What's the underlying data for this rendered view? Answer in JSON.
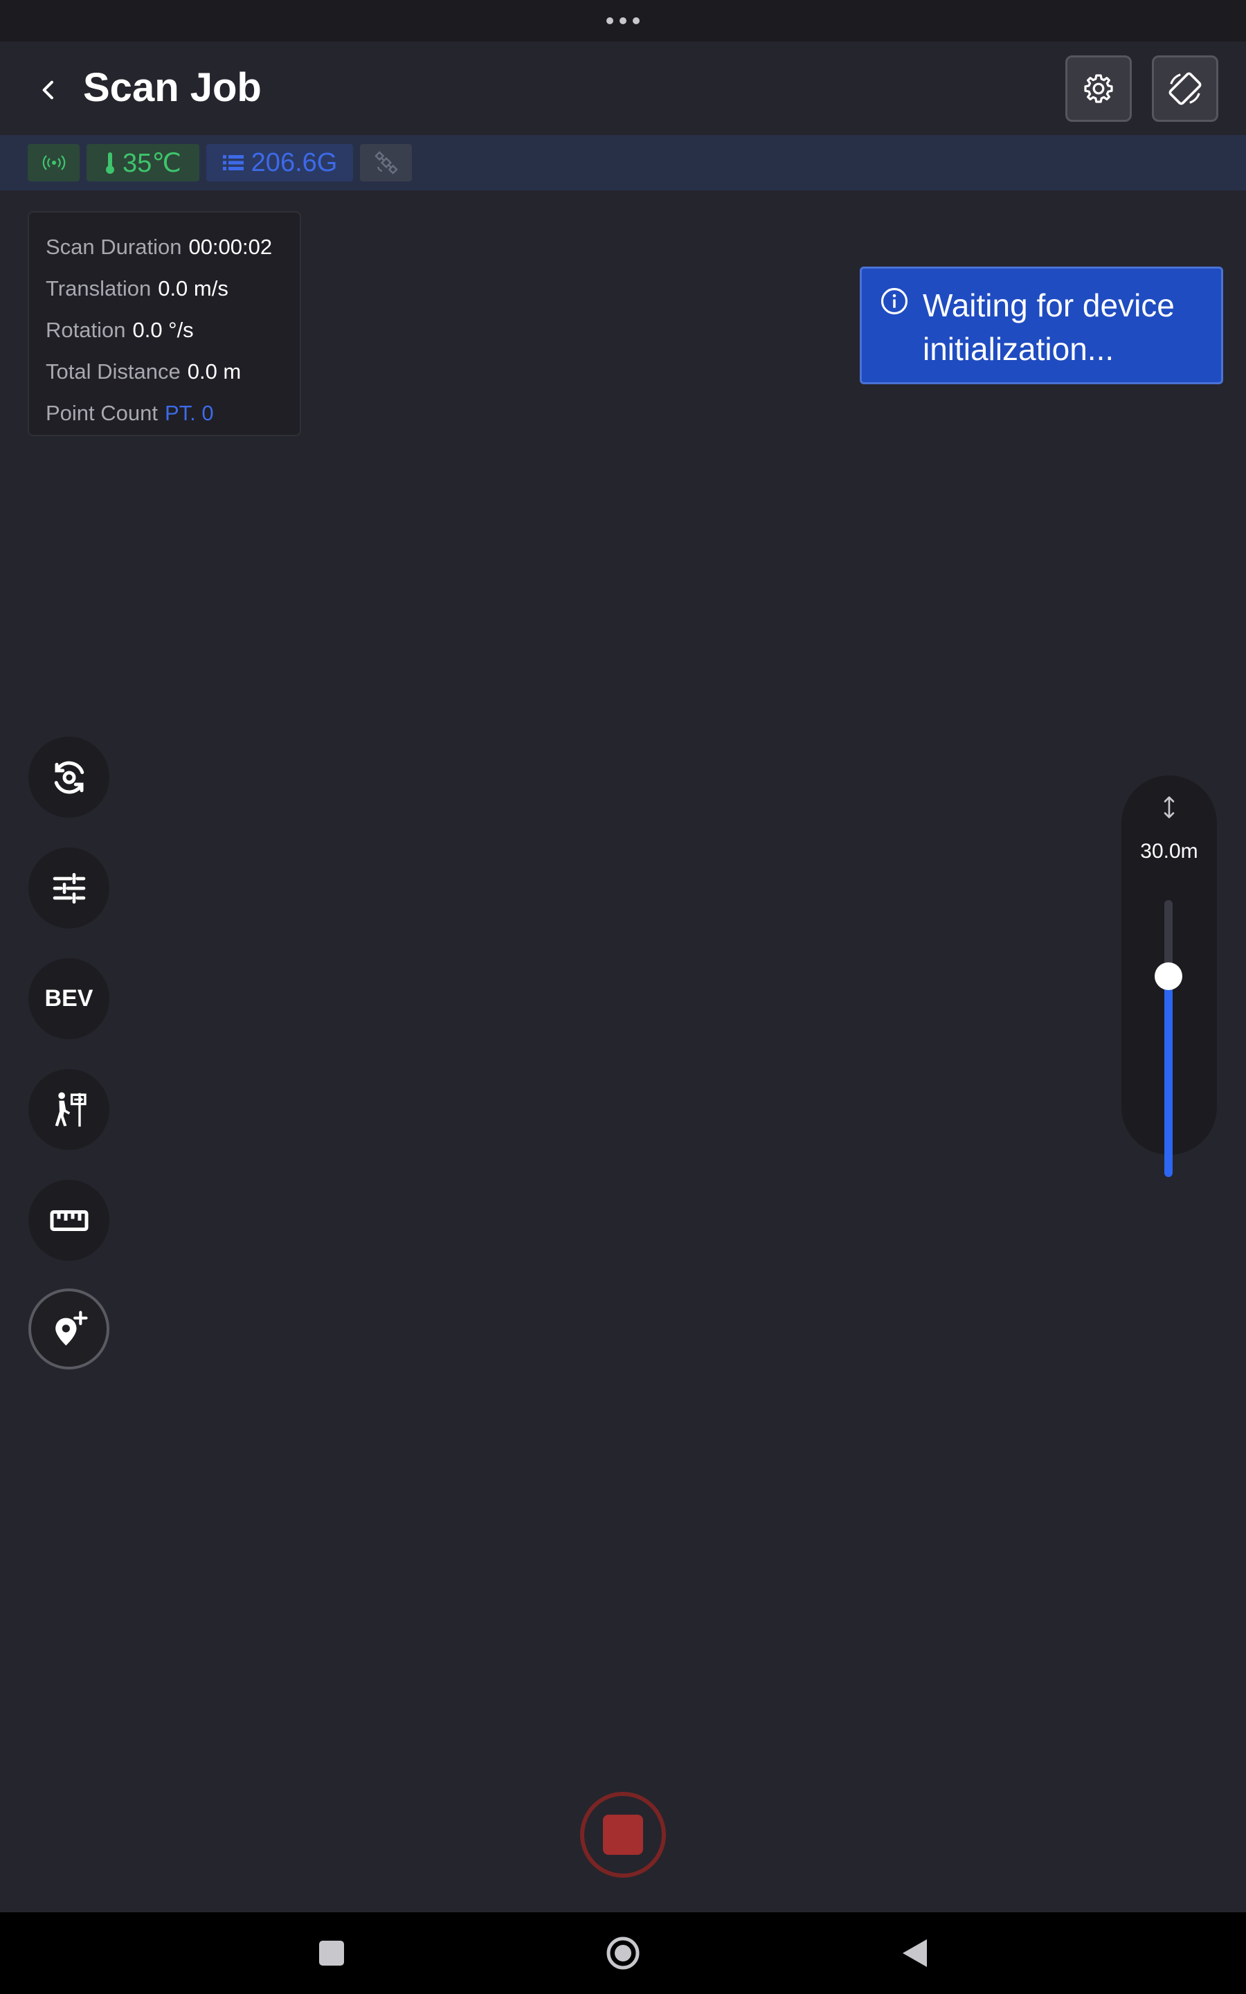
{
  "header": {
    "title": "Scan Job",
    "back_icon": "chevron-left-icon",
    "settings_icon": "gear-icon",
    "rotate_icon": "screen-rotation-icon"
  },
  "status_strip": {
    "signal_icon": "broadcast-signal-icon",
    "temperature": "35℃",
    "storage": "206.6G",
    "gps_icon": "satellite-icon",
    "colors": {
      "ok": "#3ec46d",
      "info": "#3d6ae8",
      "muted": "#6b7080"
    }
  },
  "scan_info": [
    {
      "label": "Scan Duration",
      "value": "00:00:02"
    },
    {
      "label": "Translation",
      "value": "0.0 m/s"
    },
    {
      "label": "Rotation",
      "value": "0.0 °/s"
    },
    {
      "label": "Total Distance",
      "value": "0.0 m"
    },
    {
      "label": "Point Count",
      "value": "PT. 0"
    }
  ],
  "toast": {
    "icon": "info-circle-icon",
    "line1": "Waiting for device",
    "line2": "initialization...",
    "color": "#1f4cc0"
  },
  "tools": [
    {
      "name": "reset-view",
      "icon": "reset-view-icon"
    },
    {
      "name": "adjust",
      "icon": "sliders-icon"
    },
    {
      "name": "bev",
      "label": "BEV"
    },
    {
      "name": "survey",
      "icon": "hiker-sign-icon"
    },
    {
      "name": "measure",
      "icon": "ruler-icon"
    },
    {
      "name": "add-marker",
      "icon": "add-location-icon"
    }
  ],
  "range_slider": {
    "value_label": "30.0m",
    "level": 1.0,
    "icon": "vertical-arrows-icon",
    "accent": "#2d66f0"
  },
  "record": {
    "icon": "stop-icon",
    "color": "#a52e2e"
  },
  "nav": {
    "recent_icon": "square-icon",
    "home_icon": "circle-icon",
    "back_icon": "triangle-back-icon"
  }
}
